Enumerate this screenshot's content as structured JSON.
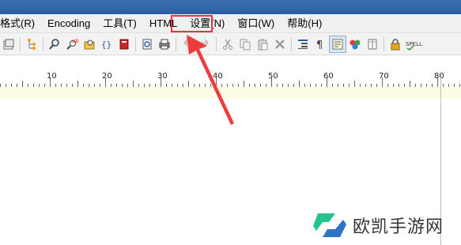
{
  "menubar": {
    "items": [
      "格式(R)",
      "Encoding",
      "工具(T)",
      "HTML",
      "设置(N)",
      "窗口(W)",
      "帮助(H)"
    ]
  },
  "toolbar": {
    "icons": [
      "window-icon",
      "tree-icon",
      "find-icon",
      "replace-icon",
      "find-in-files-icon",
      "braces-icon",
      "book-icon",
      "print-preview-icon",
      "print-icon",
      "undo-icon",
      "redo-icon",
      "cut-icon",
      "copy-icon",
      "paste-icon",
      "delete-icon",
      "indent-icon",
      "pilcrow-icon",
      "word-wrap-icon",
      "color-icon",
      "column-icon",
      "lock-icon",
      "spell-icon"
    ],
    "spell_label": "SPELL"
  },
  "ruler": {
    "labels": [
      "10",
      "20",
      "30",
      "40",
      "50",
      "60",
      "70",
      "80"
    ]
  },
  "watermark": {
    "text": "欧凯手游网"
  },
  "colors": {
    "highlight": "#e8343a",
    "titlebar": "#2c5f9f",
    "logo_green": "#22c38e",
    "logo_blue": "#2f73c9"
  }
}
